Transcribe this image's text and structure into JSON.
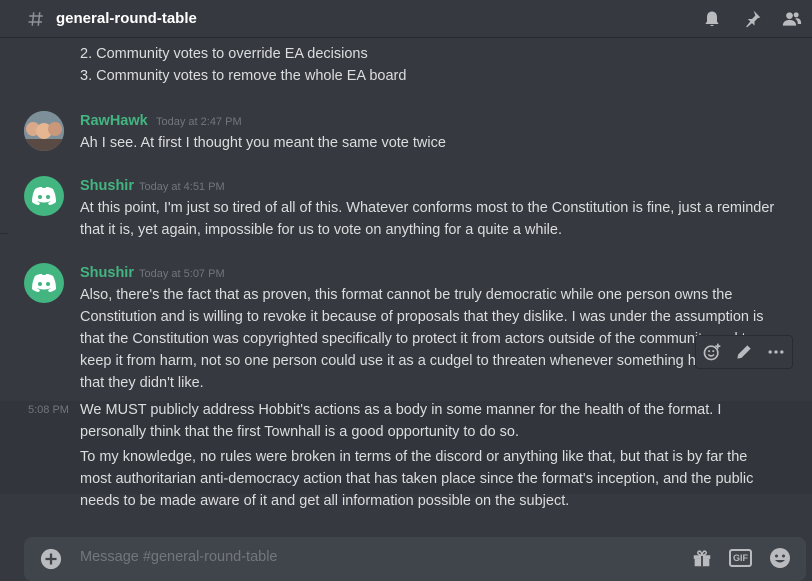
{
  "header": {
    "channel_name": "general-round-table",
    "icons": [
      "hash-icon",
      "bell-icon",
      "pin-icon",
      "members-icon"
    ]
  },
  "messages": {
    "previous_lines": [
      "2. Community votes to override EA decisions",
      "3. Community votes to remove the whole EA board"
    ],
    "group1": {
      "author": "RawHawk",
      "timestamp": "Today at 2:47 PM",
      "text": "Ah I see. At first I thought you meant the same vote twice"
    },
    "group2": {
      "author": "Shushir",
      "timestamp": "Today at 4:51 PM",
      "text": "At this point, I'm just so tired of all of this. Whatever conforms most to the Constitution is fine, just a reminder that it is, yet again, impossible for us to vote on anything for a quite a while."
    },
    "group3": {
      "author": "Shushir",
      "timestamp": "Today at 5:07 PM",
      "text": "Also, there's the fact that as proven, this format cannot be truly democratic while one person owns the Constitution and is willing to revoke it because of proposals that they dislike. I was under the assumption is that the Constitution was copyrighted specifically to protect it from actors outside of the community and to keep it from harm, not so one person could use it as a cudgel to threaten whenever something happened that they didn't like."
    },
    "followup1": {
      "timestamp": "5:08 PM",
      "text": "We MUST publicly address Hobbit's actions as a body in some manner for the health of the format. I personally think that the first Townhall is a good opportunity to do so."
    },
    "followup2": {
      "text": "To my knowledge, no rules were broken in terms of the discord or anything like that, but that is by far the most authoritarian anti-democracy action that has taken place since the format's inception, and the public needs to be made aware of it and get all information possible on the subject."
    }
  },
  "hover_toolbar": {
    "icons": [
      "add-reaction-icon",
      "edit-icon",
      "more-icon"
    ]
  },
  "composer": {
    "placeholder": "Message #general-round-table",
    "gif_label": "GIF",
    "icons": [
      "plus-icon",
      "gift-icon",
      "gif-icon",
      "emoji-icon"
    ]
  },
  "colors": {
    "background": "#36393f",
    "username": "#43b581",
    "text": "#dcddde",
    "muted": "#72767d"
  }
}
